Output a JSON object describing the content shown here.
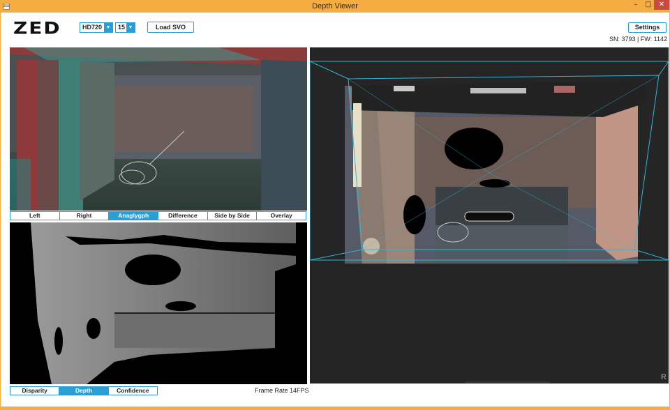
{
  "window": {
    "title": "Depth Viewer",
    "app_icon_text": "ZED",
    "minimize_glyph": "–",
    "maximize_glyph": "□",
    "close_glyph": "✕"
  },
  "toolbar": {
    "logo": "ZED",
    "resolution": "HD720",
    "fps": "15",
    "load_svo": "Load SVO",
    "settings": "Settings",
    "dropdown_arrow": "▼"
  },
  "status": {
    "sn_fw": "SN: 3793 | FW: 1142",
    "frame_rate": "Frame Rate 14FPS",
    "corner_mark": "R"
  },
  "view_tabs": [
    {
      "label": "Left",
      "active": false
    },
    {
      "label": "Right",
      "active": false
    },
    {
      "label": "Anaglygph",
      "active": true
    },
    {
      "label": "Difference",
      "active": false
    },
    {
      "label": "Side by Side",
      "active": false
    },
    {
      "label": "Overlay",
      "active": false
    }
  ],
  "depth_tabs": [
    {
      "label": "Disparity",
      "active": false
    },
    {
      "label": "Depth",
      "active": true
    },
    {
      "label": "Confidence",
      "active": false
    }
  ],
  "colors": {
    "accent": "#2a9fd6",
    "titlebar": "#f5ad41",
    "close": "#c74b41",
    "frustum": "#2fb7d8"
  }
}
